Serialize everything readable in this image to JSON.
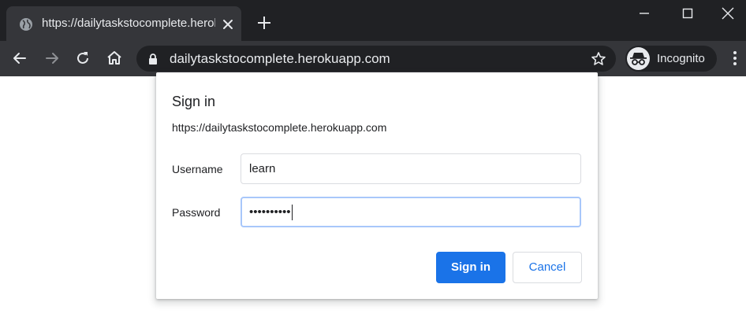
{
  "browser": {
    "tab": {
      "title": "https://dailytaskstocomplete.herokuapp.com",
      "favicon": "globe-icon"
    },
    "new_tab_icon": "plus-icon",
    "window_controls": [
      "minimize-icon",
      "maximize-icon",
      "close-icon"
    ],
    "toolbar": {
      "back_icon": "arrow-left-icon",
      "forward_icon": "arrow-right-icon",
      "reload_icon": "reload-icon",
      "home_icon": "home-icon",
      "url": "dailytaskstocomplete.herokuapp.com",
      "lock_icon": "lock-icon",
      "bookmark_icon": "star-icon",
      "profile_label": "Incognito",
      "menu_icon": "kebab-menu-icon"
    }
  },
  "dialog": {
    "title": "Sign in",
    "origin": "https://dailytaskstocomplete.herokuapp.com",
    "username_label": "Username",
    "username_value": "learn",
    "password_label": "Password",
    "password_masked": "••••••••••",
    "signin_label": "Sign in",
    "cancel_label": "Cancel"
  },
  "colors": {
    "frame": "#202124",
    "toolbar": "#35363a",
    "accent": "#1a73e8",
    "focus_ring": "#a8c7fa"
  }
}
